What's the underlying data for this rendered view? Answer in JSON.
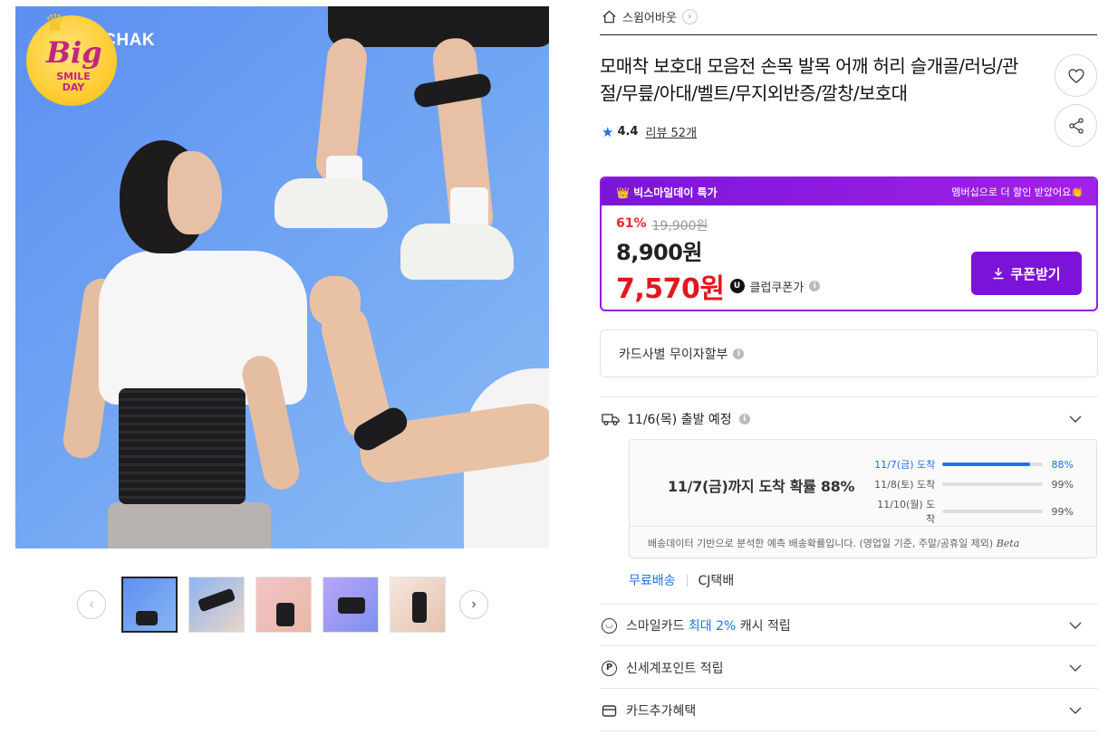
{
  "image": {
    "brand_text": "ECHAK",
    "badge": {
      "big": "Big",
      "smile_line1": "SMILE",
      "smile_line2": "DAY"
    }
  },
  "gallery": {
    "prev_glyph": "‹",
    "next_glyph": "›",
    "thumbnail_count": 5,
    "active_index": 0
  },
  "shop": {
    "name": "스윔어바웃",
    "home_icon": "home-icon",
    "chevron": "›"
  },
  "product": {
    "title": "모매착 보호대 모음전 손목 발목 어깨 허리 슬개골/러닝/관절/무릎/아대/벨트/무지외반증/깔창/보호대",
    "rating": "4.4",
    "review_label": "리뷰 52개"
  },
  "deal": {
    "header_left": "👑 빅스마일데이 특가",
    "header_right": "멤버십으로 더 할인 받았어요👏",
    "discount_pct": "61%",
    "original_price": "19,900원",
    "sale_price": "8,900원",
    "club_price": "7,570원",
    "club_badge": "U",
    "club_label": "클럽쿠폰가",
    "coupon_button": "쿠폰받기",
    "accent_color": "#7c13d9"
  },
  "installment": {
    "label": "카드사별 무이자할부"
  },
  "shipping": {
    "depart_label": "11/6(목) 출발 예정",
    "forecast_headline": "11/7(금)까지 도착 확률 88%",
    "forecast_rows": [
      {
        "date": "11/7(금) 도착",
        "percent_label": "88%",
        "value": 0.88
      },
      {
        "date": "11/8(토) 도착",
        "percent_label": "99%",
        "value": 0.0
      },
      {
        "date": "11/10(월) 도착",
        "percent_label": "99%",
        "value": 0.0
      }
    ],
    "note": "배송데이터 기반으로 분석한 예측 배송확률입니다. (영업일 기준, 주말/공휴일 제외)",
    "beta": "Beta",
    "free_shipping": "무료배송",
    "carrier": "CJ택배"
  },
  "benefits": [
    {
      "icon": "smile-card-icon",
      "prefix": "스마일카드 ",
      "highlight": "최대 2%",
      "suffix": " 캐시 적립"
    },
    {
      "icon": "point-p-icon",
      "prefix": "신세계포인트 적립",
      "highlight": "",
      "suffix": ""
    },
    {
      "icon": "card-icon",
      "prefix": "카드추가혜택",
      "highlight": "",
      "suffix": ""
    }
  ]
}
